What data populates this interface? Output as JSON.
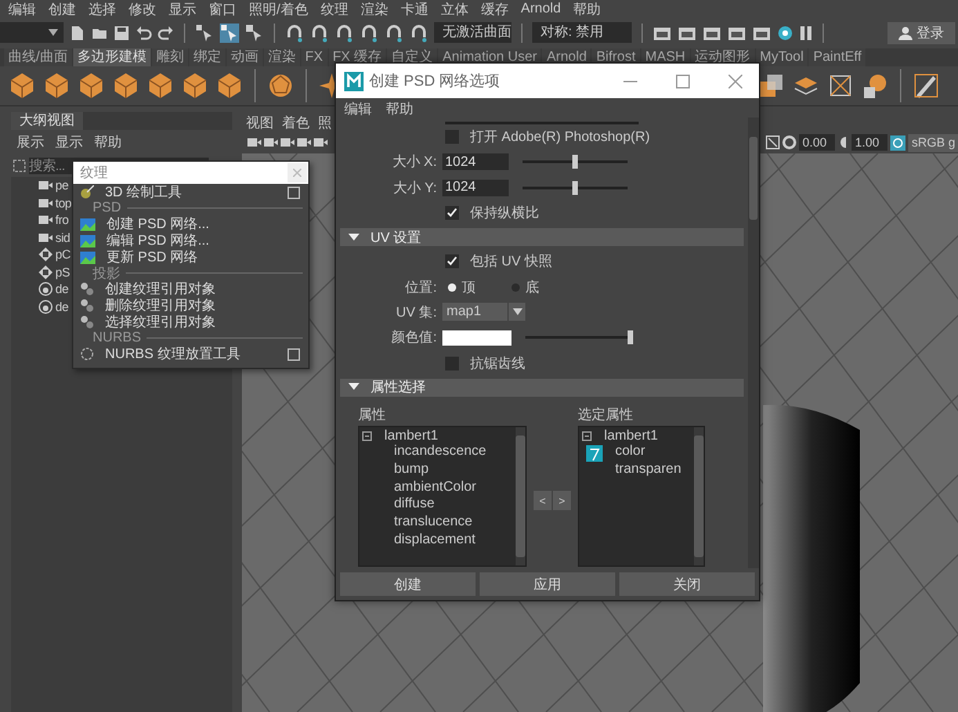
{
  "menu_bar": [
    "编辑",
    "创建",
    "选择",
    "修改",
    "显示",
    "窗口",
    "照明/着色",
    "纹理",
    "渲染",
    "卡通",
    "立体",
    "缓存",
    "Arnold",
    "帮助"
  ],
  "toolbar": {
    "surface_field": "无激活曲面",
    "symmetry_field": "对称: 禁用",
    "login_button": "登录"
  },
  "shelf_tabs": [
    {
      "label": "曲线/曲面",
      "selected": false
    },
    {
      "label": "多边形建模",
      "selected": true
    },
    {
      "label": "雕刻",
      "selected": false
    },
    {
      "label": "绑定",
      "selected": false
    },
    {
      "label": "动画",
      "selected": false
    },
    {
      "label": "渲染",
      "selected": false
    },
    {
      "label": "FX",
      "selected": false
    },
    {
      "label": "FX 缓存",
      "selected": false
    },
    {
      "label": "自定义",
      "selected": false
    },
    {
      "label": "Animation User",
      "selected": false
    },
    {
      "label": "Arnold",
      "selected": false
    },
    {
      "label": "Bifrost",
      "selected": false
    },
    {
      "label": "MASH",
      "selected": false
    },
    {
      "label": "运动图形",
      "selected": false
    },
    {
      "label": "MyTool",
      "selected": false
    },
    {
      "label": "PaintEff",
      "selected": false
    }
  ],
  "outliner": {
    "title": "大纲视图",
    "menu": [
      "展示",
      "显示",
      "帮助"
    ],
    "search": {
      "placeholder": "搜索..."
    },
    "items": [
      {
        "label": "pe",
        "kind": "camera"
      },
      {
        "label": "top",
        "kind": "camera"
      },
      {
        "label": "fro",
        "kind": "camera"
      },
      {
        "label": "sid",
        "kind": "camera"
      },
      {
        "label": "pC",
        "kind": "mesh"
      },
      {
        "label": "pS",
        "kind": "mesh"
      },
      {
        "label": "de",
        "kind": "light"
      },
      {
        "label": "de",
        "kind": "light"
      }
    ]
  },
  "viewport": {
    "menu": [
      "视图",
      "着色",
      "照"
    ],
    "exposure": "0.00",
    "gamma": "1.00",
    "color_space": "sRGB g"
  },
  "texture_menu": {
    "title": "纹理",
    "items": [
      {
        "kind": "paint",
        "label": "3D 绘制工具",
        "option_box": true
      },
      {
        "kind": "header",
        "label": "PSD"
      },
      {
        "kind": "psd",
        "label": "创建 PSD 网络...",
        "option_box": false
      },
      {
        "kind": "psd",
        "label": "编辑 PSD 网络...",
        "option_box": false
      },
      {
        "kind": "psd",
        "label": "更新 PSD 网络",
        "option_box": false
      },
      {
        "kind": "header",
        "label": "投影"
      },
      {
        "kind": "projection",
        "label": "创建纹理引用对象",
        "option_box": false
      },
      {
        "kind": "projection",
        "label": "删除纹理引用对象",
        "option_box": false
      },
      {
        "kind": "projection",
        "label": "选择纹理引用对象",
        "option_box": false
      },
      {
        "kind": "header",
        "label": "NURBS"
      },
      {
        "kind": "nurbs",
        "label": "NURBS 纹理放置工具",
        "option_box": true
      }
    ]
  },
  "dialog": {
    "title": "创建 PSD 网络选项",
    "menu": [
      "编辑",
      "帮助"
    ],
    "open_photoshop": {
      "label": "打开 Adobe(R) Photoshop(R)",
      "checked": false
    },
    "size_x": {
      "label": "大小 X:",
      "value": "1024",
      "level": 0.5
    },
    "size_y": {
      "label": "大小 Y:",
      "value": "1024",
      "level": 0.5
    },
    "keep_ratio": {
      "label": "保持纵横比",
      "checked": true
    },
    "uv_section": {
      "title": "UV 设置",
      "expanded": true
    },
    "include_uv": {
      "label": "包括 UV 快照",
      "checked": true
    },
    "position": {
      "label": "位置:",
      "options": [
        {
          "label": "顶",
          "selected": true
        },
        {
          "label": "底",
          "selected": false
        }
      ]
    },
    "uv_set": {
      "label": "UV 集:",
      "value": "map1"
    },
    "color_value": {
      "label": "颜色值:",
      "level": 1
    },
    "antialias": {
      "label": "抗锯齿线",
      "checked": false
    },
    "attr_section": {
      "title": "属性选择",
      "expanded": true
    },
    "attributes": {
      "label": "属性",
      "node": "lambert1",
      "expanded": true,
      "children": [
        {
          "label": "incandescence"
        },
        {
          "label": "bump"
        },
        {
          "label": "ambientColor"
        },
        {
          "label": "diffuse"
        },
        {
          "label": "translucence"
        },
        {
          "label": "displacement"
        }
      ]
    },
    "move_buttons": [
      "<",
      ">"
    ],
    "selected_attributes": {
      "label": "选定属性",
      "node": "lambert1",
      "expanded": true,
      "children": [
        {
          "label": "color",
          "icon": true
        },
        {
          "label": "transparen",
          "icon": false
        }
      ]
    },
    "buttons": [
      "创建",
      "应用",
      "关闭"
    ]
  }
}
